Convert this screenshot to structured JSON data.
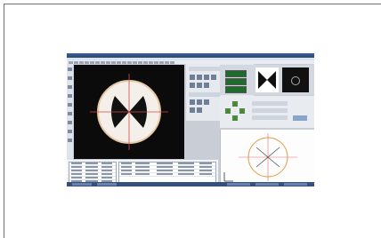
{
  "page": {
    "description_visible_text": ""
  },
  "app": {
    "window_title": "",
    "menu": [],
    "toolbar_icons": [
      "icon-1",
      "icon-2",
      "icon-3",
      "icon-4",
      "icon-5",
      "icon-6",
      "icon-7",
      "icon-8",
      "icon-9",
      "icon-10",
      "icon-11",
      "icon-12",
      "icon-13",
      "icon-14",
      "icon-15",
      "icon-16",
      "icon-17",
      "icon-18",
      "icon-19",
      "icon-20"
    ],
    "colors": {
      "titlebar": "#2f5386",
      "viewport_bg": "#0b0b0b",
      "target_ring": "#e6c7a3",
      "target_fill": "#f4efe8",
      "crosshair": "#d84a4a",
      "lcd": "#1f6b2d",
      "sketch_circle": "#e2a14a",
      "statusbar": "#34507c"
    }
  },
  "left_tools": [
    "tool-1",
    "tool-2",
    "tool-3",
    "tool-4",
    "tool-5",
    "tool-6",
    "tool-7",
    "tool-8",
    "tool-9"
  ],
  "right_panel": {
    "rows": 6
  },
  "indicators": {
    "lcd_count": 3
  },
  "bottom_tables": {
    "left_rows": 6,
    "right_rows": 4
  }
}
